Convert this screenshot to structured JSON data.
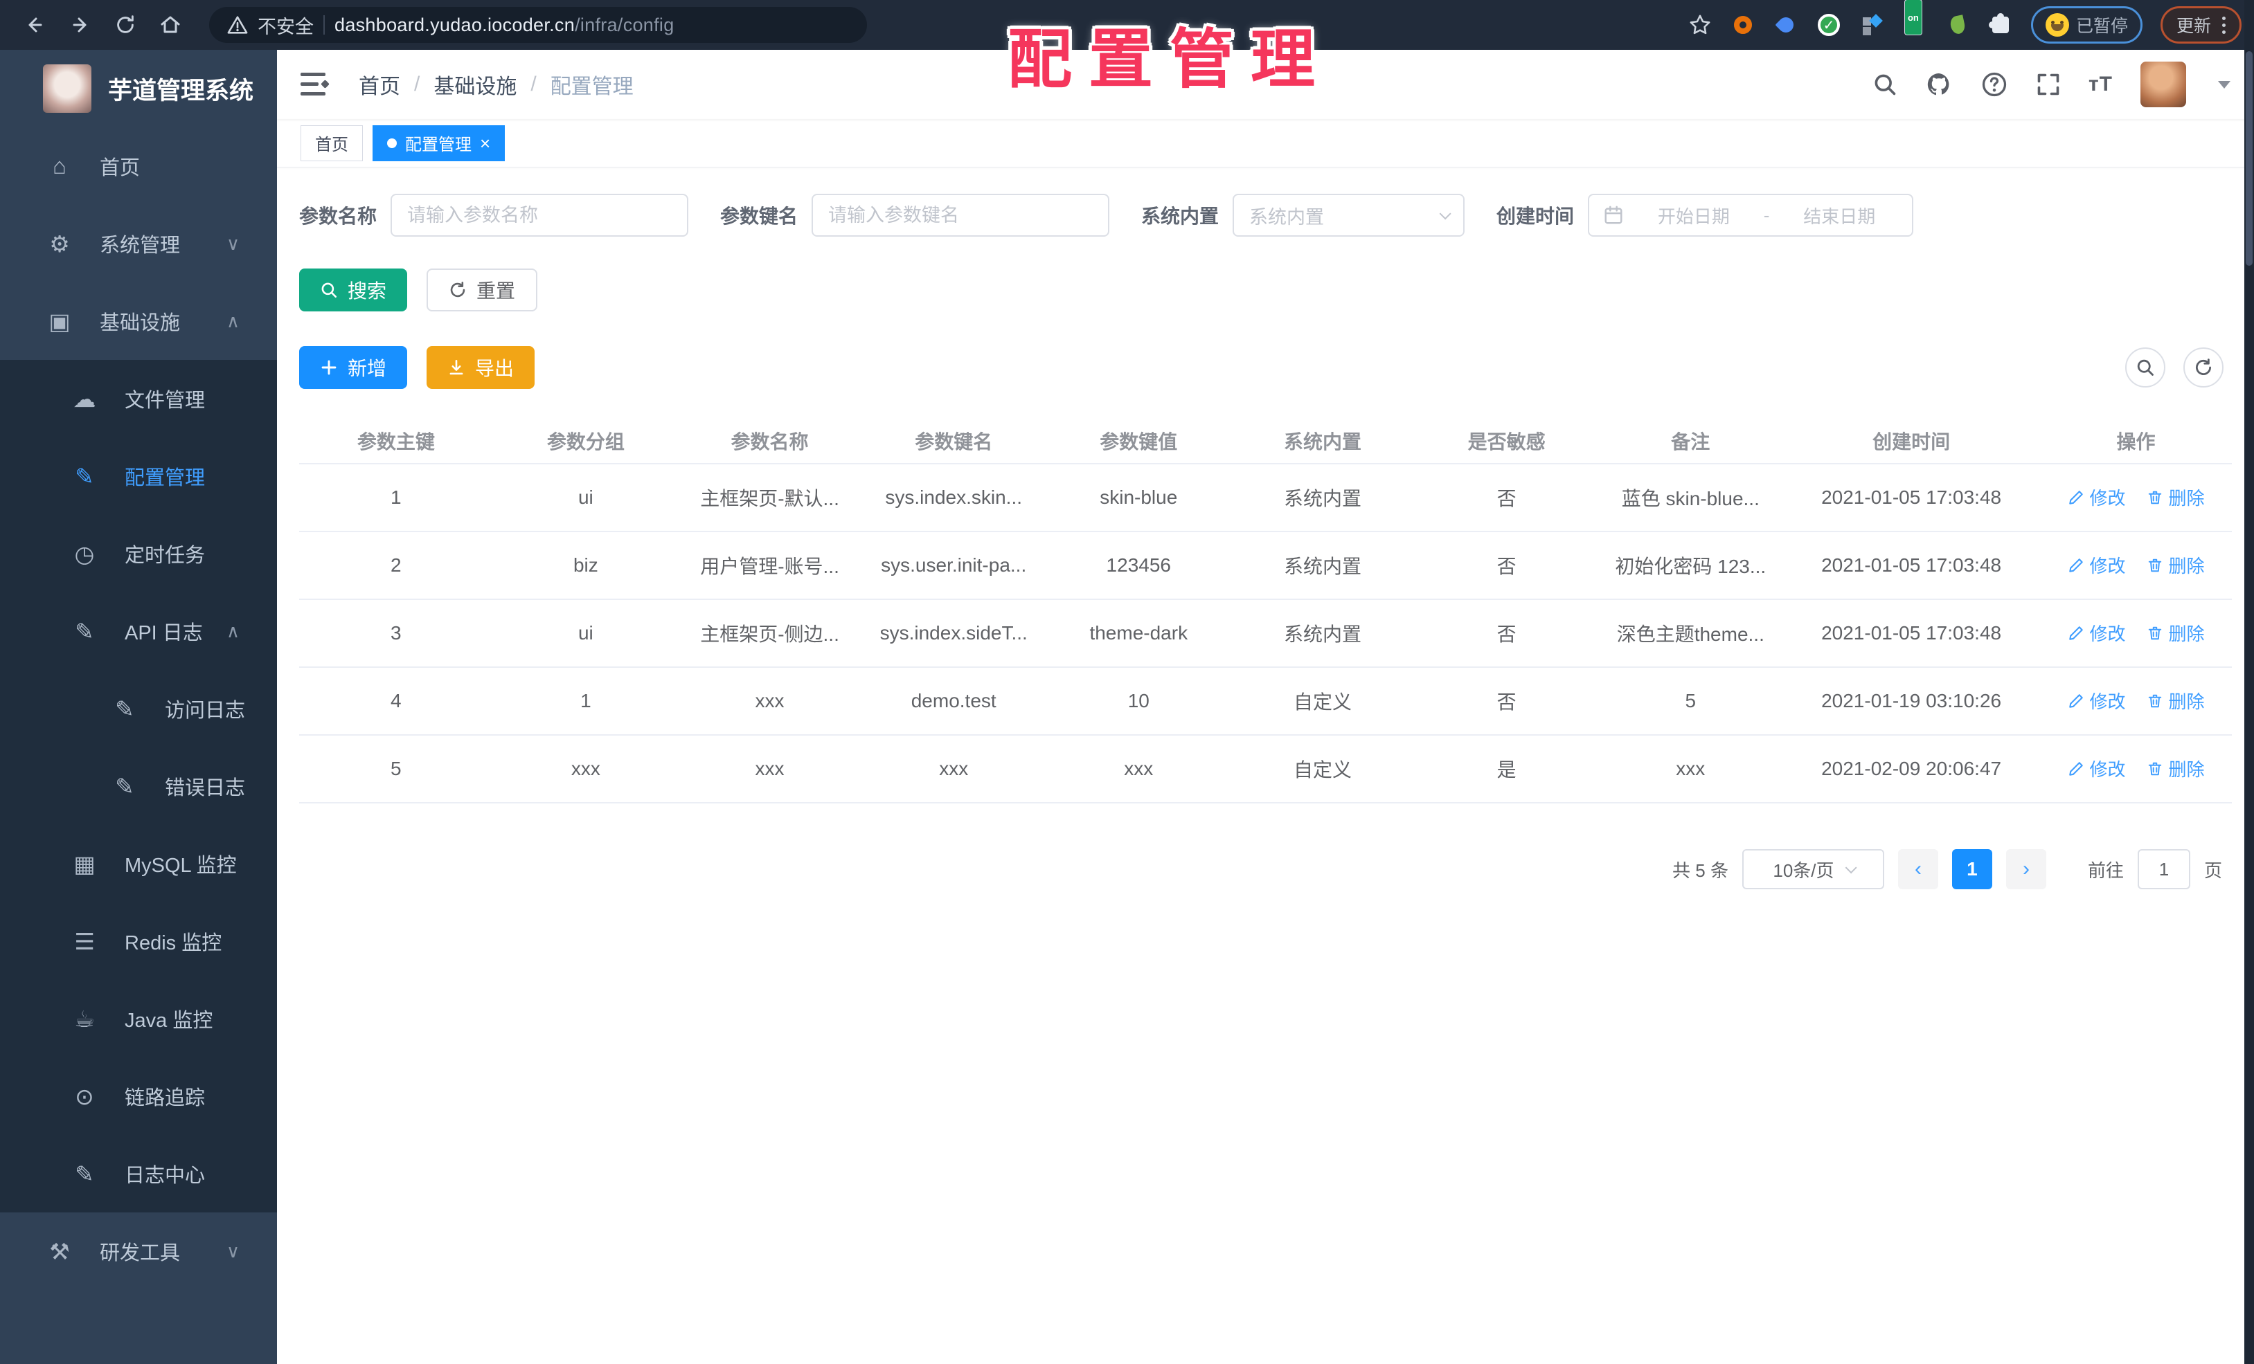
{
  "overlay_title": "配置管理",
  "browser": {
    "security_label": "不安全",
    "url_host": "dashboard.yudao.iocoder.cn",
    "url_path": "/infra/config",
    "paused_label": "已暂停",
    "update_label": "更新",
    "on_badge": "on"
  },
  "sidebar": {
    "logo_title": "芋道管理系统",
    "items": [
      {
        "label": "首页",
        "icon": "home-icon"
      },
      {
        "label": "系统管理",
        "icon": "gear-icon",
        "chevron": "down"
      },
      {
        "label": "基础设施",
        "icon": "monitor-icon",
        "chevron": "up"
      },
      {
        "label": "文件管理",
        "icon": "cloud-icon"
      },
      {
        "label": "配置管理",
        "icon": "edit-icon",
        "active": true
      },
      {
        "label": "定时任务",
        "icon": "timer-icon"
      },
      {
        "label": "API 日志",
        "icon": "log-icon",
        "chevron": "up"
      },
      {
        "label": "访问日志",
        "icon": "log-icon"
      },
      {
        "label": "错误日志",
        "icon": "log-icon"
      },
      {
        "label": "MySQL 监控",
        "icon": "database-icon"
      },
      {
        "label": "Redis 监控",
        "icon": "layers-icon"
      },
      {
        "label": "Java 监控",
        "icon": "java-icon"
      },
      {
        "label": "链路追踪",
        "icon": "eye-icon"
      },
      {
        "label": "日志中心",
        "icon": "log-icon"
      },
      {
        "label": "研发工具",
        "icon": "toolbox-icon",
        "chevron": "down"
      }
    ]
  },
  "header": {
    "breadcrumb": [
      "首页",
      "基础设施",
      "配置管理"
    ]
  },
  "tags": {
    "home": "首页",
    "active": "配置管理"
  },
  "filters": {
    "name_label": "参数名称",
    "name_placeholder": "请输入参数名称",
    "key_label": "参数键名",
    "key_placeholder": "请输入参数键名",
    "type_label": "系统内置",
    "type_placeholder": "系统内置",
    "date_label": "创建时间",
    "date_start": "开始日期",
    "date_separator": "-",
    "date_end": "结束日期"
  },
  "toolbar": {
    "search": "搜索",
    "reset": "重置",
    "add": "新增",
    "export": "导出"
  },
  "table": {
    "columns": [
      "参数主键",
      "参数分组",
      "参数名称",
      "参数键名",
      "参数键值",
      "系统内置",
      "是否敏感",
      "备注",
      "创建时间",
      "操作"
    ],
    "edit_label": "修改",
    "delete_label": "删除",
    "rows": [
      {
        "id": "1",
        "group": "ui",
        "name": "主框架页-默认...",
        "key": "sys.index.skin...",
        "value": "skin-blue",
        "type": "系统内置",
        "sensitive": "否",
        "remark": "蓝色 skin-blue...",
        "created": "2021-01-05 17:03:48"
      },
      {
        "id": "2",
        "group": "biz",
        "name": "用户管理-账号...",
        "key": "sys.user.init-pa...",
        "value": "123456",
        "type": "系统内置",
        "sensitive": "否",
        "remark": "初始化密码 123...",
        "created": "2021-01-05 17:03:48"
      },
      {
        "id": "3",
        "group": "ui",
        "name": "主框架页-侧边...",
        "key": "sys.index.sideT...",
        "value": "theme-dark",
        "type": "系统内置",
        "sensitive": "否",
        "remark": "深色主题theme...",
        "created": "2021-01-05 17:03:48"
      },
      {
        "id": "4",
        "group": "1",
        "name": "xxx",
        "key": "demo.test",
        "value": "10",
        "type": "自定义",
        "sensitive": "否",
        "remark": "5",
        "created": "2021-01-19 03:10:26"
      },
      {
        "id": "5",
        "group": "xxx",
        "name": "xxx",
        "key": "xxx",
        "value": "xxx",
        "type": "自定义",
        "sensitive": "是",
        "remark": "xxx",
        "created": "2021-02-09 20:06:47"
      }
    ]
  },
  "pagination": {
    "total": "共 5 条",
    "page_size": "10条/页",
    "prev": "‹",
    "next": "›",
    "current_page": "1",
    "goto_label": "前往",
    "goto_value": "1",
    "page_unit": "页"
  },
  "colors": {
    "accent_blue": "#1890ff",
    "link_blue": "#409eff",
    "success_teal": "#11a983",
    "warning_orange": "#f2a516",
    "overlay_red": "#f5365c",
    "sidebar_bg": "#304156",
    "submenu_bg": "#1f2d3d",
    "browser_bg": "#212b3a"
  }
}
